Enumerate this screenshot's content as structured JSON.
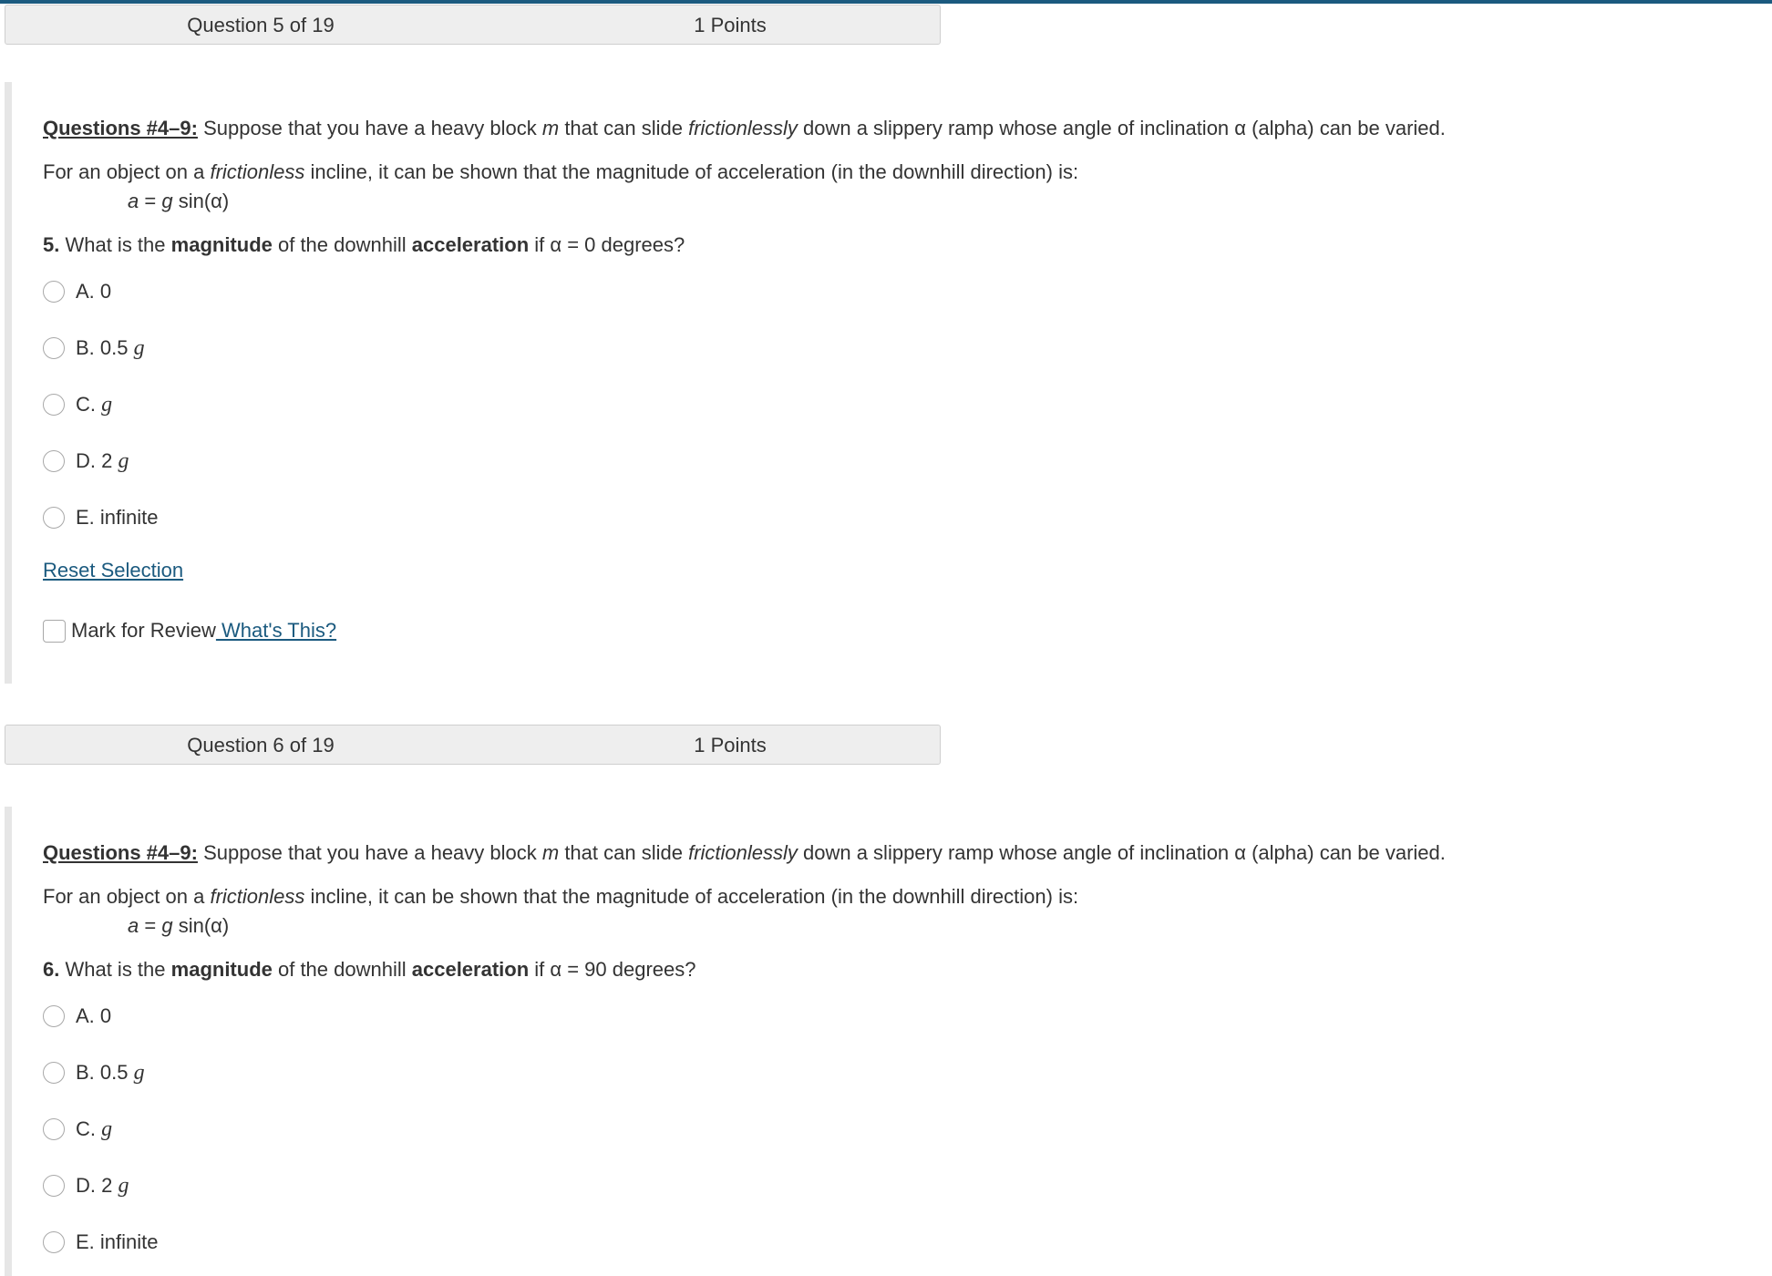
{
  "colors": {
    "accent": "#1b5a7f",
    "header_bg": "#eeeeee"
  },
  "questions": [
    {
      "header": {
        "number": "Question 5 of 19",
        "points": "1 Points"
      },
      "intro_label": "Questions #4–9:",
      "intro": {
        "a": " Suppose that you have a heavy block ",
        "m": "m",
        "b": " that can slide ",
        "fl": "frictionlessly",
        "c": " down a slippery ramp whose angle of inclination α (alpha) can be varied."
      },
      "line2": {
        "a": "For an object on a ",
        "fl": "frictionless",
        "b": " incline, it can be shown that the magnitude of acceleration (in the downhill direction) is:"
      },
      "formula": {
        "a": "a",
        "eq": " = ",
        "g": "g",
        "sin": " sin(α)"
      },
      "prompt": {
        "num": "5.",
        "a": " What is the ",
        "b1": "magnitude",
        "b": " of the downhill ",
        "b2": "acceleration",
        "c": " if α = 0 degrees?"
      },
      "options": [
        {
          "text": "A. 0",
          "var": ""
        },
        {
          "text": "B. 0.5 ",
          "var": "g"
        },
        {
          "text": "C. ",
          "var": "g"
        },
        {
          "text": "D. 2 ",
          "var": "g"
        },
        {
          "text": "E. infinite",
          "var": ""
        }
      ],
      "reset": "Reset Selection",
      "mark": "Mark for Review",
      "whats_this": " What's This?"
    },
    {
      "header": {
        "number": "Question 6 of 19",
        "points": "1 Points"
      },
      "intro_label": "Questions #4–9:",
      "intro": {
        "a": " Suppose that you have a heavy block ",
        "m": "m",
        "b": " that can slide ",
        "fl": "frictionlessly",
        "c": " down a slippery ramp whose angle of inclination α (alpha) can be varied."
      },
      "line2": {
        "a": "For an object on a ",
        "fl": "frictionless",
        "b": " incline, it can be shown that the magnitude of acceleration (in the downhill direction) is:"
      },
      "formula": {
        "a": "a",
        "eq": " = ",
        "g": "g",
        "sin": " sin(α)"
      },
      "prompt": {
        "num": "6.",
        "a": " What is the ",
        "b1": "magnitude",
        "b": " of the downhill ",
        "b2": "acceleration",
        "c": " if α = 90 degrees?"
      },
      "options": [
        {
          "text": "A. 0",
          "var": ""
        },
        {
          "text": "B. 0.5 ",
          "var": "g"
        },
        {
          "text": "C. ",
          "var": "g"
        },
        {
          "text": "D. 2 ",
          "var": "g"
        },
        {
          "text": "E. infinite",
          "var": ""
        }
      ]
    }
  ]
}
